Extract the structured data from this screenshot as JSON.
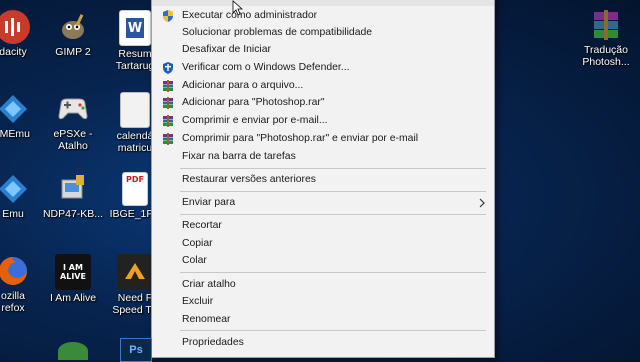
{
  "desktop": {
    "icons": [
      {
        "name": "audacity-icon",
        "label": "dacity",
        "color": "#c83a2a",
        "glyph": ""
      },
      {
        "name": "gimp-icon",
        "label": "GIMP 2",
        "color": "#7a6a50",
        "glyph": ""
      },
      {
        "name": "word-icon",
        "label": "Resum\nTartarug",
        "color": "#2b579a",
        "glyph": "W"
      },
      {
        "name": "memu-icon",
        "label": "-MEmu",
        "color": "#2a7fd0",
        "glyph": ""
      },
      {
        "name": "epsxe-icon",
        "label": "ePSXe -\nAtalho",
        "color": "#d8d8d8",
        "glyph": ""
      },
      {
        "name": "calendar-icon",
        "label": "calendá\nmatricu",
        "color": "#e8e8e8",
        "glyph": ""
      },
      {
        "name": "emu-icon",
        "label": "Emu",
        "color": "#2a7fd0",
        "glyph": ""
      },
      {
        "name": "ndp-icon",
        "label": "NDP47-KB...",
        "color": "#4a90d9",
        "glyph": ""
      },
      {
        "name": "pdf-icon",
        "label": "IBGE_1PS",
        "color": "#c41e1e",
        "glyph": "PDF"
      },
      {
        "name": "firefox-icon",
        "label": "ozilla\nrefox",
        "color": "#e66000",
        "glyph": ""
      },
      {
        "name": "i-am-alive-icon",
        "label": "I Am Alive",
        "color": "#111111",
        "glyph": "I AM ALIVE"
      },
      {
        "name": "need-for-speed-icon",
        "label": "Need F\nSpeed Th",
        "color": "#222222",
        "glyph": ""
      },
      {
        "name": "winrar-icon",
        "label": "Tradução\nPhotosh...",
        "color": "#7a2d8c",
        "glyph": ""
      }
    ]
  },
  "context_menu": {
    "items": [
      {
        "label": "Executar como administrador",
        "icon": "shield-icon"
      },
      {
        "label": "Solucionar problemas de compatibilidade",
        "icon": ""
      },
      {
        "label": "Desafixar de Iniciar",
        "icon": ""
      },
      {
        "label": "Verificar com o Windows Defender...",
        "icon": "defender-icon"
      },
      {
        "label": "Adicionar para o arquivo...",
        "icon": "winrar-icon"
      },
      {
        "label": "Adicionar para \"Photoshop.rar\"",
        "icon": "winrar-icon"
      },
      {
        "label": "Comprimir e enviar por e-mail...",
        "icon": "winrar-icon"
      },
      {
        "label": "Comprimir para \"Photoshop.rar\" e enviar por e-mail",
        "icon": "winrar-icon"
      },
      {
        "label": "Fixar na barra de tarefas",
        "icon": ""
      },
      {
        "label": "Restaurar versões anteriores",
        "icon": ""
      },
      {
        "label": "Enviar para",
        "icon": ""
      },
      {
        "label": "Recortar",
        "icon": ""
      },
      {
        "label": "Copiar",
        "icon": ""
      },
      {
        "label": "Colar",
        "icon": ""
      },
      {
        "label": "Criar atalho",
        "icon": ""
      },
      {
        "label": "Excluir",
        "icon": ""
      },
      {
        "label": "Renomear",
        "icon": ""
      },
      {
        "label": "Propriedades",
        "icon": ""
      }
    ]
  },
  "taskbar": {
    "items": [
      {
        "label": "Ps",
        "color": "#0a2a4a"
      }
    ]
  }
}
